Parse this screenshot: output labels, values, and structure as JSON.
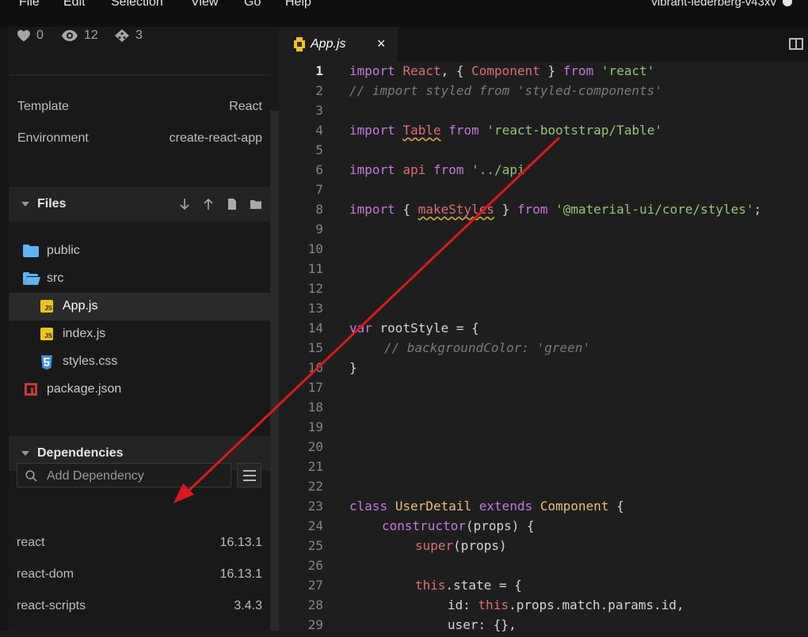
{
  "menubar": {
    "items": [
      "File",
      "Edit",
      "Selection",
      "View",
      "Go",
      "Help"
    ],
    "project_name": "vibrant-lederberg-v43xv"
  },
  "sidebar": {
    "stats": {
      "likes": "0",
      "views": "12",
      "forks": "3"
    },
    "info": [
      {
        "label": "Template",
        "value": "React"
      },
      {
        "label": "Environment",
        "value": "create-react-app"
      }
    ],
    "files_title": "Files",
    "files": [
      {
        "name": "public",
        "type": "folder"
      },
      {
        "name": "src",
        "type": "folder-open"
      },
      {
        "name": "App.js",
        "type": "js",
        "active": true
      },
      {
        "name": "index.js",
        "type": "js"
      },
      {
        "name": "styles.css",
        "type": "css"
      },
      {
        "name": "package.json",
        "type": "npm"
      }
    ],
    "dependencies_title": "Dependencies",
    "dependency_search_placeholder": "Add Dependency",
    "dependencies": [
      {
        "name": "react",
        "version": "16.13.1"
      },
      {
        "name": "react-dom",
        "version": "16.13.1"
      },
      {
        "name": "react-scripts",
        "version": "3.4.3"
      }
    ]
  },
  "editor": {
    "tab_label": "App.js",
    "tab_close": "×",
    "current_line": 1,
    "line_numbers": [
      "1",
      "2",
      "3",
      "4",
      "5",
      "6",
      "7",
      "8",
      "9",
      "10",
      "11",
      "12",
      "13",
      "14",
      "15",
      "16",
      "17",
      "18",
      "19",
      "20",
      "21",
      "22",
      "23",
      "24",
      "25",
      "26",
      "27",
      "28",
      "29"
    ],
    "code": {
      "l1": {
        "import": "import",
        "react": "React",
        "comma": ", { ",
        "component": "Component",
        "close": " } ",
        "from": "from",
        "str": "'react'"
      },
      "l2": "// import styled from 'styled-components'",
      "l4": {
        "import": "import",
        "table": "Table",
        "from": "from",
        "str": "'react-bootstrap/Table'"
      },
      "l6": {
        "import": "import",
        "api": "api",
        "from": "from",
        "str": "'../api'"
      },
      "l8": {
        "import": "import",
        "open": "{ ",
        "makeStyles": "makeStyles",
        "close": " }",
        "from": "from",
        "str": "'@material-ui/core/styles'",
        "semi": ";"
      },
      "l14": {
        "var": "var",
        "name": " rootStyle = {"
      },
      "l15": "// backgroundColor: 'green'",
      "l16": "}",
      "l23": {
        "class": "class",
        "name": "UserDetail",
        "extends": "extends",
        "base": "Component",
        "brace": " {"
      },
      "l24": {
        "ctor": "constructor",
        "rest": "(props) {"
      },
      "l25": {
        "super": "super",
        "rest": "(props)"
      },
      "l27": {
        "this": "this",
        "rest": ".state = {"
      },
      "l28": {
        "key": "id:",
        "this": "this",
        "rest": ".props.match.params.id,"
      },
      "l29": {
        "key": "user: {},"
      }
    }
  },
  "colors": {
    "annotation_arrow": "#e0171a",
    "keyword": "#c678dd",
    "identifier": "#e06c75",
    "string": "#98c379",
    "comment": "#7a7a7a",
    "class_name": "#e5c07b"
  }
}
